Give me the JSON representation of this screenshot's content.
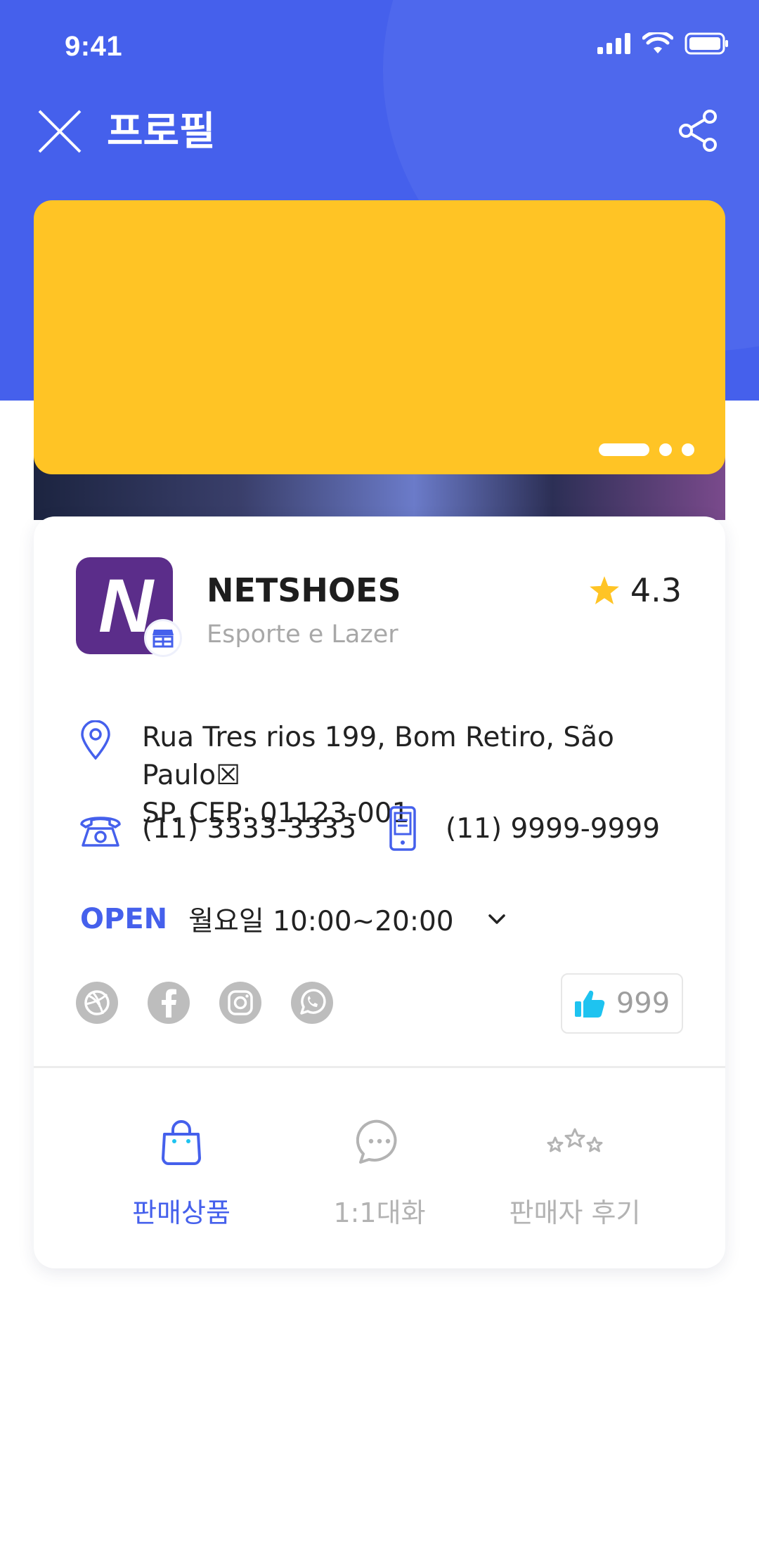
{
  "status_bar": {
    "time": "9:41"
  },
  "header": {
    "title": "프로필"
  },
  "colors": {
    "primary": "#4560ec",
    "banner": "#ffc425",
    "store_logo": "#5b2d8a",
    "star": "#ffc425",
    "like": "#1ec3f0",
    "muted": "#bdbdbd"
  },
  "banner": {
    "slides": 3,
    "active_slide": 1
  },
  "store": {
    "logo_letter": "N",
    "name": "NETSHOES",
    "category": "Esporte e Lazer",
    "rating": "4.3",
    "address_line1": "Rua Tres rios 199, Bom Retiro,  São Paulo☒",
    "address_line2": "SP.  CEP: 01123-001",
    "phone": "(11) 3333-3333",
    "mobile": "(11) 9999-9999",
    "open_label": "OPEN",
    "hours": "월요일 10:00~20:00",
    "likes": "999"
  },
  "socials": [
    {
      "icon": "dribbble-icon"
    },
    {
      "icon": "facebook-icon"
    },
    {
      "icon": "instagram-icon"
    },
    {
      "icon": "whatsapp-icon"
    }
  ],
  "tabs": [
    {
      "label": "판매상품",
      "icon": "shopping-bag-icon",
      "active": true
    },
    {
      "label": "1:1대화",
      "icon": "chat-icon",
      "active": false
    },
    {
      "label": "판매자 후기",
      "icon": "stars-icon",
      "active": false
    }
  ]
}
